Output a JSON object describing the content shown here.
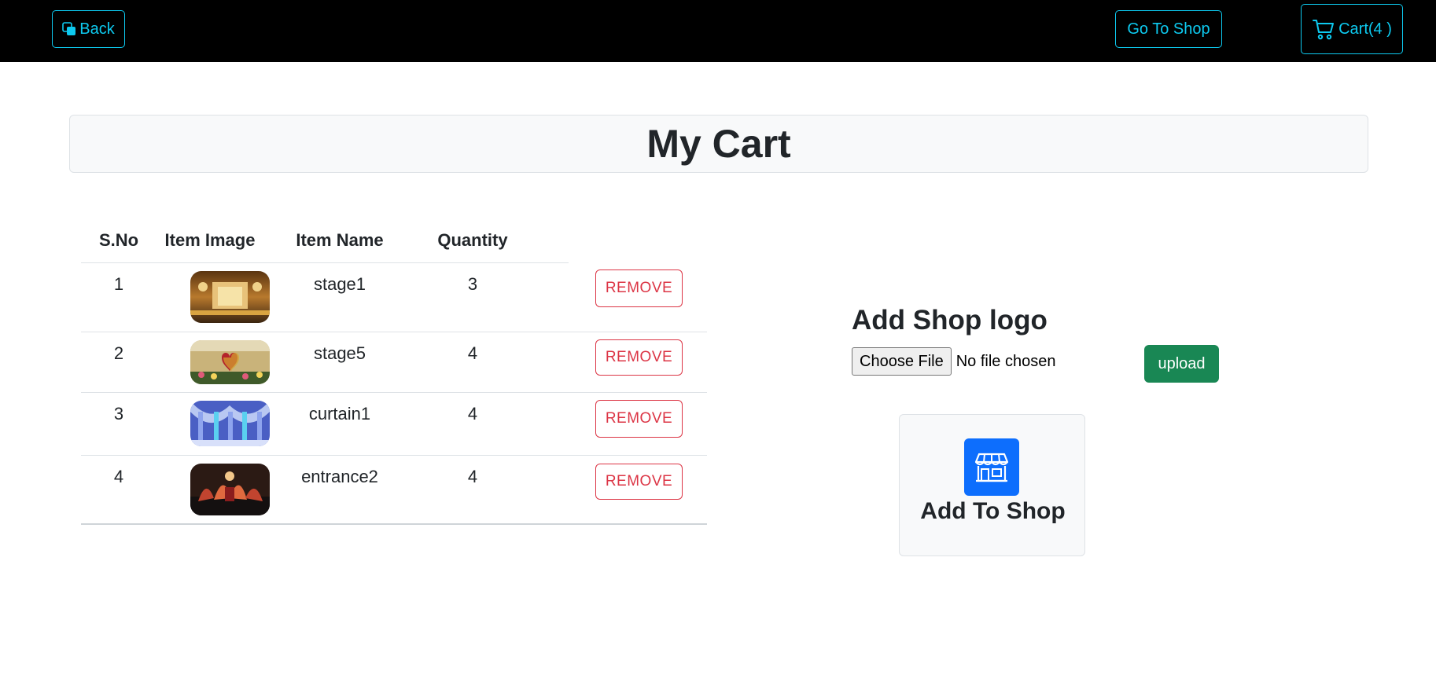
{
  "navbar": {
    "back_label": "Back",
    "go_to_shop_label": "Go To Shop",
    "cart_label": "Cart(4 )"
  },
  "page_title": "My Cart",
  "table": {
    "headers": [
      "S.No",
      "Item Image",
      "Item Name",
      "Quantity"
    ],
    "rows": [
      {
        "sno": "1",
        "name": "stage1",
        "quantity": "3",
        "action": "REMOVE"
      },
      {
        "sno": "2",
        "name": "stage5",
        "quantity": "4",
        "action": "REMOVE"
      },
      {
        "sno": "3",
        "name": "curtain1",
        "quantity": "4",
        "action": "REMOVE"
      },
      {
        "sno": "4",
        "name": "entrance2",
        "quantity": "4",
        "action": "REMOVE"
      }
    ]
  },
  "logo_panel": {
    "heading": "Add Shop logo",
    "choose_file_label": "Choose File",
    "no_file_text": "No file chosen",
    "upload_label": "upload"
  },
  "shop_card": {
    "label": "Add To Shop",
    "icon": "shop-icon"
  },
  "colors": {
    "navbar_bg": "#000000",
    "nav_accent": "#0dcaf0",
    "danger": "#dc3545",
    "success": "#198754",
    "primary": "#0d6efd"
  }
}
